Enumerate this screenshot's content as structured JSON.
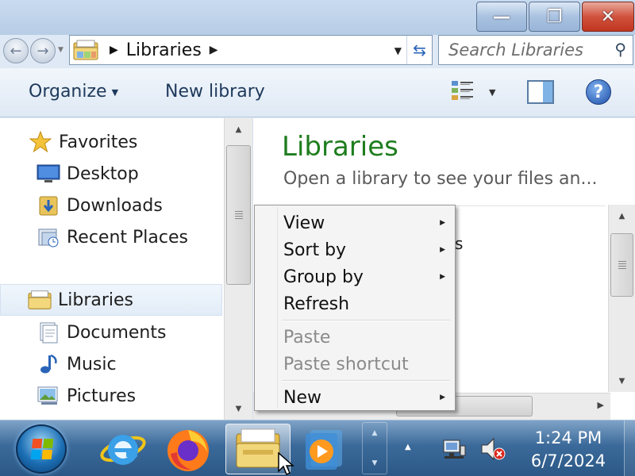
{
  "window": {
    "minimize_glyph": "—",
    "maximize_glyph": "❐",
    "close_glyph": "✕"
  },
  "address_bar": {
    "path": "Libraries",
    "refresh_icon": "refresh-arrows-icon"
  },
  "search": {
    "placeholder": "Search Libraries"
  },
  "toolbar": {
    "organize_label": "Organize",
    "new_library_label": "New library"
  },
  "nav_pane": {
    "items": [
      {
        "label": "Favorites",
        "icon": "star-icon"
      },
      {
        "label": "Desktop",
        "icon": "desktop-icon"
      },
      {
        "label": "Downloads",
        "icon": "downloads-folder-icon"
      },
      {
        "label": "Recent Places",
        "icon": "recent-places-icon"
      },
      {
        "label": "Libraries",
        "icon": "libraries-folder-icon",
        "selected": true
      },
      {
        "label": "Documents",
        "icon": "documents-icon"
      },
      {
        "label": "Music",
        "icon": "music-icon"
      },
      {
        "label": "Pictures",
        "icon": "pictures-icon"
      }
    ]
  },
  "content": {
    "title": "Libraries",
    "subtitle": "Open a library to see your files an...",
    "peek_text": "s"
  },
  "context_menu": {
    "items": [
      {
        "label": "View",
        "submenu": true,
        "enabled": true
      },
      {
        "label": "Sort by",
        "submenu": true,
        "enabled": true
      },
      {
        "label": "Group by",
        "submenu": true,
        "enabled": true
      },
      {
        "label": "Refresh",
        "submenu": false,
        "enabled": true
      },
      {
        "label": "Paste",
        "submenu": false,
        "enabled": false
      },
      {
        "label": "Paste shortcut",
        "submenu": false,
        "enabled": false
      },
      {
        "label": "New",
        "submenu": true,
        "enabled": true
      }
    ]
  },
  "taskbar": {
    "time": "1:24 PM",
    "date": "6/7/2024"
  },
  "colors": {
    "library_title": "#1e7d1e",
    "taskbar": "#2b5886",
    "close_button": "#c1351f"
  }
}
